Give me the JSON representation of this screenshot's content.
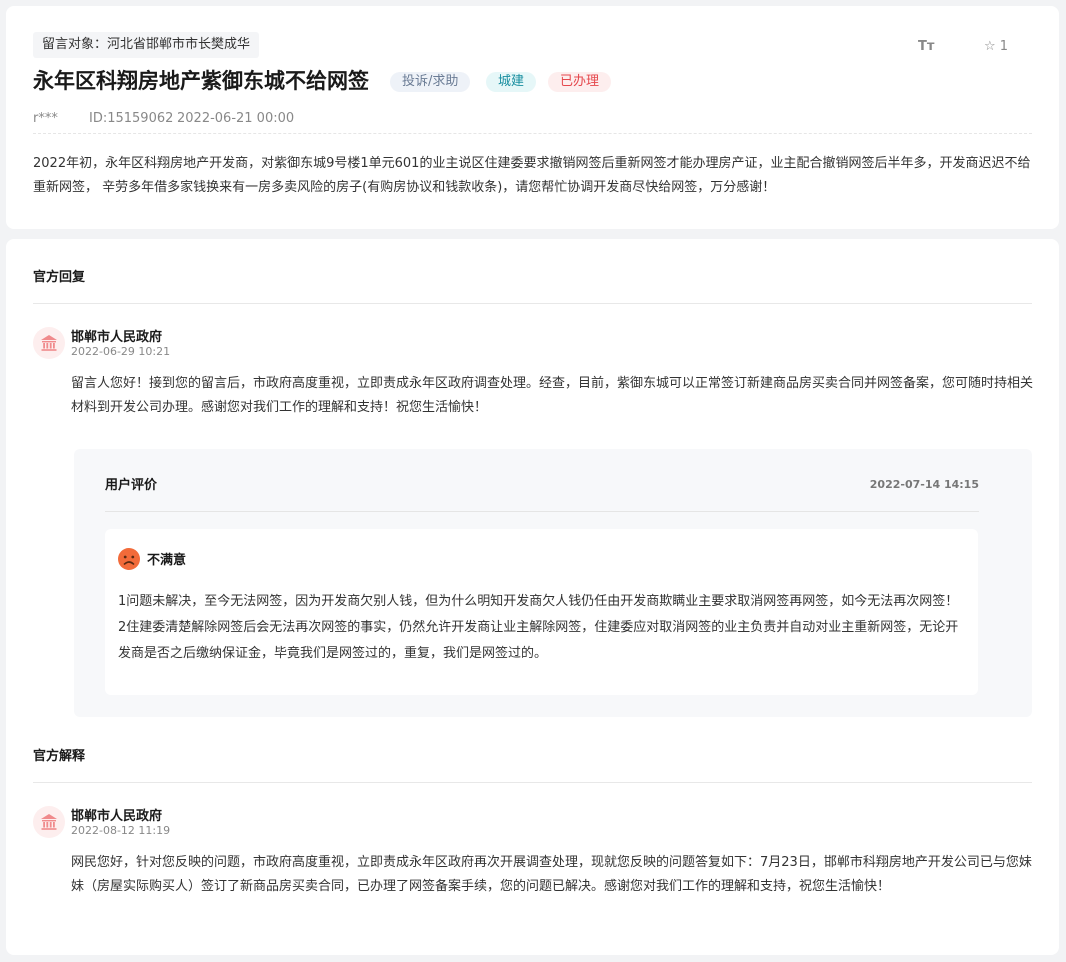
{
  "message": {
    "target_label": "留言对象：河北省邯郸市市长樊成华",
    "title": "永年区科翔房地产紫御东城不给网签",
    "tags": {
      "type": "投诉/求助",
      "domain": "城建",
      "status": "已办理"
    },
    "user": "r***",
    "id_text": "ID:15159062",
    "date": "2022-06-21 00:00",
    "tools": {
      "font_size_label": "Tт",
      "favorite_count": "1"
    },
    "content": "2022年初，永年区科翔房地产开发商，对紫御东城9号楼1单元601的业主说区住建委要求撤销网签后重新网签才能办理房产证，业主配合撤销网签后半年多，开发商迟迟不给重新网签， 辛劳多年借多家钱换来有一房多卖风险的房子(有购房协议和钱款收条)，请您帮忙协调开发商尽快给网签，万分感谢！"
  },
  "official_reply": {
    "section_title": "官方回复",
    "org_name": "邯郸市人民政府",
    "time": "2022-06-29 10:21",
    "content": "留言人您好！接到您的留言后，市政府高度重视，立即责成永年区政府调查处理。经查，目前，紫御东城可以正常签订新建商品房买卖合同并网签备案，您可随时持相关材料到开发公司办理。感谢您对我们工作的理解和支持！祝您生活愉快！"
  },
  "user_evaluation": {
    "title": "用户评价",
    "date": "2022-07-14 14:15",
    "mood": "不满意",
    "lines": [
      "1问题未解决，至今无法网签，因为开发商欠别人钱，但为什么明知开发商欠人钱仍任由开发商欺瞒业主要求取消网签再网签，如今无法再次网签！",
      "2住建委清楚解除网签后会无法再次网签的事实，仍然允许开发商让业主解除网签，住建委应对取消网签的业主负责并自动对业主重新网签，无论开发商是否之后缴纳保证金，毕竟我们是网签过的，重复，我们是网签过的。"
    ]
  },
  "official_explanation": {
    "section_title": "官方解释",
    "org_name": "邯郸市人民政府",
    "time": "2022-08-12 11:19",
    "content": "网民您好，针对您反映的问题，市政府高度重视，立即责成永年区政府再次开展调查处理，现就您反映的问题答复如下：7月23日，邯郸市科翔房地产开发公司已与您妹妹（房屋实际购买人）签订了新商品房买卖合同，已办理了网签备案手续，您的问题已解决。感谢您对我们工作的理解和支持，祝您生活愉快！"
  },
  "colors": {
    "accent_red": "#e5484d",
    "accent_teal": "#1a8fa0",
    "tag_gray": "#6b7c95"
  }
}
